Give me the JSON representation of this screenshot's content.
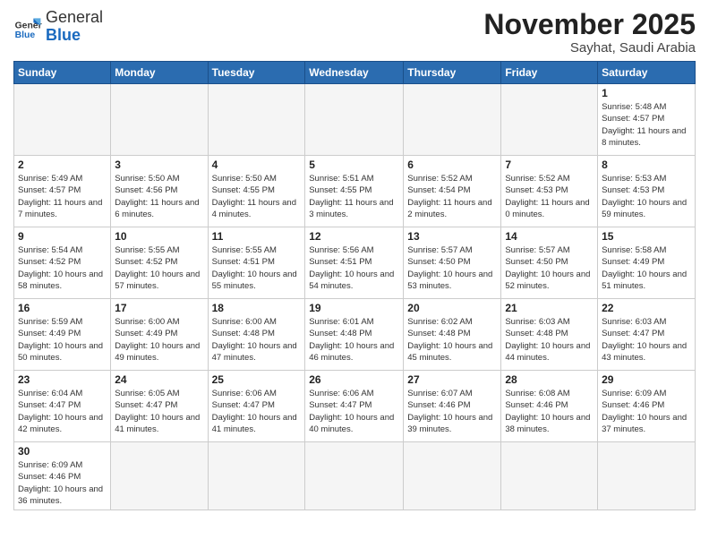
{
  "logo": {
    "general": "General",
    "blue": "Blue"
  },
  "header": {
    "month": "November 2025",
    "location": "Sayhat, Saudi Arabia"
  },
  "days_of_week": [
    "Sunday",
    "Monday",
    "Tuesday",
    "Wednesday",
    "Thursday",
    "Friday",
    "Saturday"
  ],
  "weeks": [
    [
      {
        "day": "",
        "info": ""
      },
      {
        "day": "",
        "info": ""
      },
      {
        "day": "",
        "info": ""
      },
      {
        "day": "",
        "info": ""
      },
      {
        "day": "",
        "info": ""
      },
      {
        "day": "",
        "info": ""
      },
      {
        "day": "1",
        "info": "Sunrise: 5:48 AM\nSunset: 4:57 PM\nDaylight: 11 hours and 8 minutes."
      }
    ],
    [
      {
        "day": "2",
        "info": "Sunrise: 5:49 AM\nSunset: 4:57 PM\nDaylight: 11 hours and 7 minutes."
      },
      {
        "day": "3",
        "info": "Sunrise: 5:50 AM\nSunset: 4:56 PM\nDaylight: 11 hours and 6 minutes."
      },
      {
        "day": "4",
        "info": "Sunrise: 5:50 AM\nSunset: 4:55 PM\nDaylight: 11 hours and 4 minutes."
      },
      {
        "day": "5",
        "info": "Sunrise: 5:51 AM\nSunset: 4:55 PM\nDaylight: 11 hours and 3 minutes."
      },
      {
        "day": "6",
        "info": "Sunrise: 5:52 AM\nSunset: 4:54 PM\nDaylight: 11 hours and 2 minutes."
      },
      {
        "day": "7",
        "info": "Sunrise: 5:52 AM\nSunset: 4:53 PM\nDaylight: 11 hours and 0 minutes."
      },
      {
        "day": "8",
        "info": "Sunrise: 5:53 AM\nSunset: 4:53 PM\nDaylight: 10 hours and 59 minutes."
      }
    ],
    [
      {
        "day": "9",
        "info": "Sunrise: 5:54 AM\nSunset: 4:52 PM\nDaylight: 10 hours and 58 minutes."
      },
      {
        "day": "10",
        "info": "Sunrise: 5:55 AM\nSunset: 4:52 PM\nDaylight: 10 hours and 57 minutes."
      },
      {
        "day": "11",
        "info": "Sunrise: 5:55 AM\nSunset: 4:51 PM\nDaylight: 10 hours and 55 minutes."
      },
      {
        "day": "12",
        "info": "Sunrise: 5:56 AM\nSunset: 4:51 PM\nDaylight: 10 hours and 54 minutes."
      },
      {
        "day": "13",
        "info": "Sunrise: 5:57 AM\nSunset: 4:50 PM\nDaylight: 10 hours and 53 minutes."
      },
      {
        "day": "14",
        "info": "Sunrise: 5:57 AM\nSunset: 4:50 PM\nDaylight: 10 hours and 52 minutes."
      },
      {
        "day": "15",
        "info": "Sunrise: 5:58 AM\nSunset: 4:49 PM\nDaylight: 10 hours and 51 minutes."
      }
    ],
    [
      {
        "day": "16",
        "info": "Sunrise: 5:59 AM\nSunset: 4:49 PM\nDaylight: 10 hours and 50 minutes."
      },
      {
        "day": "17",
        "info": "Sunrise: 6:00 AM\nSunset: 4:49 PM\nDaylight: 10 hours and 49 minutes."
      },
      {
        "day": "18",
        "info": "Sunrise: 6:00 AM\nSunset: 4:48 PM\nDaylight: 10 hours and 47 minutes."
      },
      {
        "day": "19",
        "info": "Sunrise: 6:01 AM\nSunset: 4:48 PM\nDaylight: 10 hours and 46 minutes."
      },
      {
        "day": "20",
        "info": "Sunrise: 6:02 AM\nSunset: 4:48 PM\nDaylight: 10 hours and 45 minutes."
      },
      {
        "day": "21",
        "info": "Sunrise: 6:03 AM\nSunset: 4:48 PM\nDaylight: 10 hours and 44 minutes."
      },
      {
        "day": "22",
        "info": "Sunrise: 6:03 AM\nSunset: 4:47 PM\nDaylight: 10 hours and 43 minutes."
      }
    ],
    [
      {
        "day": "23",
        "info": "Sunrise: 6:04 AM\nSunset: 4:47 PM\nDaylight: 10 hours and 42 minutes."
      },
      {
        "day": "24",
        "info": "Sunrise: 6:05 AM\nSunset: 4:47 PM\nDaylight: 10 hours and 41 minutes."
      },
      {
        "day": "25",
        "info": "Sunrise: 6:06 AM\nSunset: 4:47 PM\nDaylight: 10 hours and 41 minutes."
      },
      {
        "day": "26",
        "info": "Sunrise: 6:06 AM\nSunset: 4:47 PM\nDaylight: 10 hours and 40 minutes."
      },
      {
        "day": "27",
        "info": "Sunrise: 6:07 AM\nSunset: 4:46 PM\nDaylight: 10 hours and 39 minutes."
      },
      {
        "day": "28",
        "info": "Sunrise: 6:08 AM\nSunset: 4:46 PM\nDaylight: 10 hours and 38 minutes."
      },
      {
        "day": "29",
        "info": "Sunrise: 6:09 AM\nSunset: 4:46 PM\nDaylight: 10 hours and 37 minutes."
      }
    ],
    [
      {
        "day": "30",
        "info": "Sunrise: 6:09 AM\nSunset: 4:46 PM\nDaylight: 10 hours and 36 minutes."
      },
      {
        "day": "",
        "info": ""
      },
      {
        "day": "",
        "info": ""
      },
      {
        "day": "",
        "info": ""
      },
      {
        "day": "",
        "info": ""
      },
      {
        "day": "",
        "info": ""
      },
      {
        "day": "",
        "info": ""
      }
    ]
  ]
}
